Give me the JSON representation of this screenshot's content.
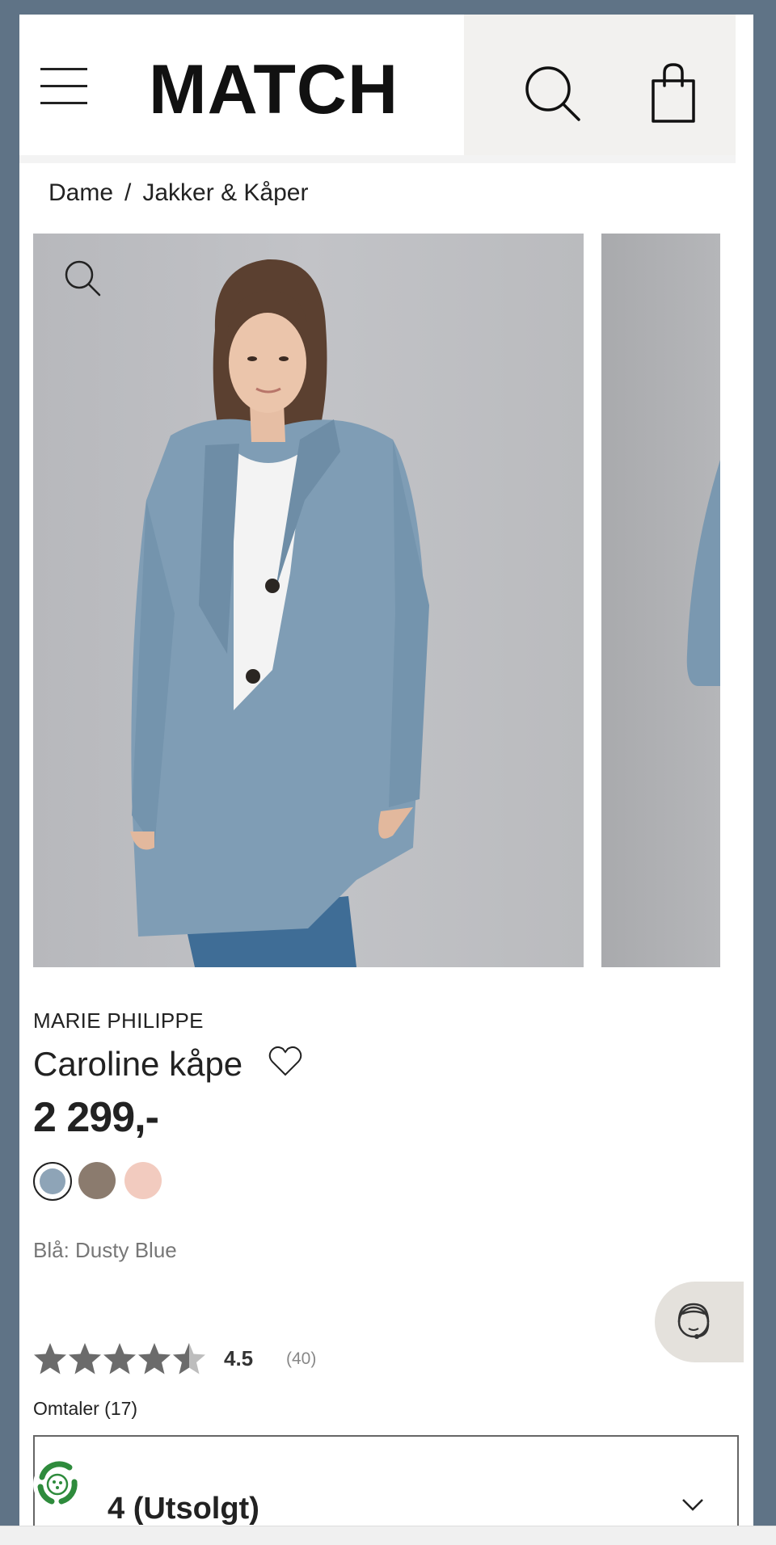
{
  "header": {
    "logo": "MATCH",
    "menu_icon": "hamburger-menu-icon",
    "search_icon": "search-icon",
    "bag_icon": "shopping-bag-icon"
  },
  "breadcrumb": {
    "items": [
      "Dame",
      "Jakker & Kåper"
    ],
    "separator": "/"
  },
  "gallery": {
    "zoom_icon": "zoom-icon"
  },
  "product": {
    "brand": "MARIE PHILIPPE",
    "name": "Caroline kåpe",
    "price": "2 299,-",
    "wishlist_icon": "heart-icon",
    "color_label": "Blå: Dusty Blue",
    "swatches": [
      {
        "color": "#8ea4b7",
        "selected": true
      },
      {
        "color": "#8b7b6e",
        "selected": false
      },
      {
        "color": "#f2cbbf",
        "selected": false
      }
    ]
  },
  "rating": {
    "value": "4.5",
    "count": "(40)",
    "stars": 4.5,
    "reviews_label": "Omtaler (17)"
  },
  "size_select": {
    "label": "4 (Utsolgt)",
    "chevron_icon": "chevron-down-icon"
  },
  "chat": {
    "icon": "support-agent-icon"
  },
  "eco": {
    "icon": "eco-recycle-icon"
  },
  "colors": {
    "frame": "#5f7386",
    "header_right_bg": "#f2f1ef",
    "coat": "#7f9db5",
    "chat_bg": "#e4e1dc",
    "eco_green": "#2e8b3c"
  }
}
